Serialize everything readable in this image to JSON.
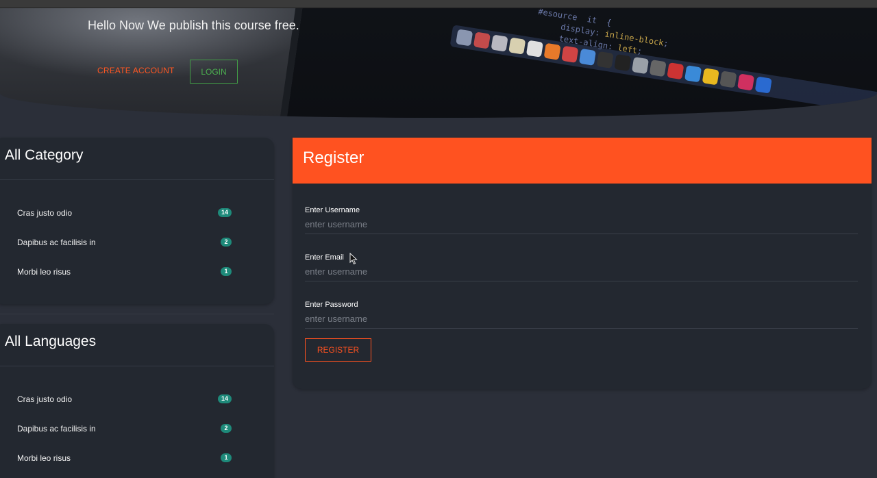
{
  "hero": {
    "tagline": "Hello Now We publish this course free.",
    "create_account_label": "CREATE ACCOUNT",
    "login_label": "LOGIN"
  },
  "categories": {
    "title": "All Category",
    "items": [
      {
        "label": "Cras justo odio",
        "count": "14"
      },
      {
        "label": "Dapibus ac facilisis in",
        "count": "2"
      },
      {
        "label": "Morbi leo risus",
        "count": "1"
      }
    ]
  },
  "languages": {
    "title": "All Languages",
    "items": [
      {
        "label": "Cras justo odio",
        "count": "14"
      },
      {
        "label": "Dapibus ac facilisis in",
        "count": "2"
      },
      {
        "label": "Morbi leo risus",
        "count": "1"
      }
    ]
  },
  "register": {
    "title": "Register",
    "fields": [
      {
        "label": "Enter Username",
        "placeholder": "enter username"
      },
      {
        "label": "Enter Email",
        "placeholder": "enter username"
      },
      {
        "label": "Enter Password",
        "placeholder": "enter username"
      }
    ],
    "submit_label": "REGISTER"
  },
  "colors": {
    "accent": "#ff5220",
    "login_green": "#4caf50",
    "badge": "#1e8a7a",
    "panel_bg": "#232830",
    "page_bg": "#2b2f39"
  }
}
